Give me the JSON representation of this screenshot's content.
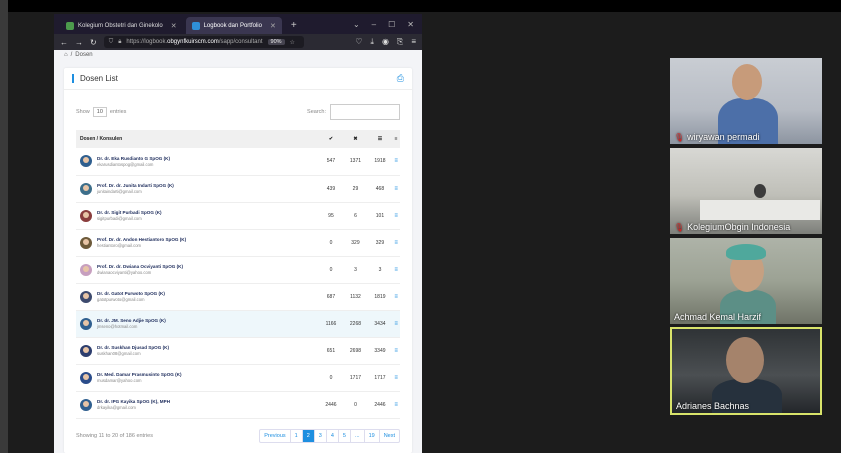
{
  "browser": {
    "tabs": [
      {
        "label": "Kolegium Obstetri dan Ginekolo",
        "active": false
      },
      {
        "label": "Logbook dan Portfolio",
        "active": true
      }
    ],
    "new_tab": "+",
    "url_prefix": "https://logbook.",
    "url_domain": "obgynfkuirscm.com",
    "url_path": "/sapp/consultant",
    "zoom": "90%"
  },
  "breadcrumb": {
    "home": "⌂",
    "sep": "/",
    "current": "Dosen"
  },
  "card": {
    "title": "Dosen List",
    "show_label": "Show",
    "entries_value": "10",
    "entries_label": "entries",
    "search_label": "Search:",
    "search_value": ""
  },
  "table": {
    "headers": [
      "Dosen / Konsulen",
      "✔",
      "✖",
      "☰",
      "≡"
    ],
    "rows": [
      {
        "name": "Dr. dr. Eka Rusdianto G SpOG (K)",
        "email": "ekarusdiantospog@gmail.com",
        "c1": "547",
        "c2": "1371",
        "c3": "1918"
      },
      {
        "name": "Prof. Dr. dr. Junita Indarti SpOG (K)",
        "email": "junitaindarti@gmail.com",
        "c1": "439",
        "c2": "29",
        "c3": "468"
      },
      {
        "name": "Dr. dr. Sigit Purbadi SpOG (K)",
        "email": "sigitpurbadi@gmail.com",
        "c1": "95",
        "c2": "6",
        "c3": "101"
      },
      {
        "name": "Prof. Dr. dr. Andon Hestiantoro SpOG (K)",
        "email": "hestiantoro@gmail.com",
        "c1": "0",
        "c2": "329",
        "c3": "329"
      },
      {
        "name": "Prof. Dr. dr. Dwiana Ocviyanti SpOG (K)",
        "email": "dwianaocviyanti@yahoo.com",
        "c1": "0",
        "c2": "3",
        "c3": "3"
      },
      {
        "name": "Dr. dr. Gatot Purwoto SpOG (K)",
        "email": "gatotpurwoto@gmail.com",
        "c1": "687",
        "c2": "1132",
        "c3": "1819"
      },
      {
        "name": "Dr. dr. JM. Seno Adjie SpOG (K)",
        "email": "jmseno@hotmail.com",
        "c1": "1166",
        "c2": "2268",
        "c3": "3434"
      },
      {
        "name": "Dr. dr. Suskhan Djusad SpOG (K)",
        "email": "suskhan08@gmail.com",
        "c1": "651",
        "c2": "2698",
        "c3": "3349"
      },
      {
        "name": "Dr. Med. Damar Prasmusinto SpOG (K)",
        "email": "musdamar@yahoo.com",
        "c1": "0",
        "c2": "1717",
        "c3": "1717"
      },
      {
        "name": "Dr. dr. IPG Kayika SpOG (K), MPH",
        "email": "drkayika@gmail.com",
        "c1": "2446",
        "c2": "0",
        "c3": "2446"
      }
    ],
    "row_action": "≡"
  },
  "footer": {
    "info": "Showing 11 to 20 of 186 entries",
    "pages": [
      "Previous",
      "1",
      "2",
      "3",
      "4",
      "5",
      "...",
      "19",
      "Next"
    ],
    "active_page": "2"
  },
  "participants": [
    {
      "name": "wiryawan permadi",
      "muted": true
    },
    {
      "name": "KolegiumObgin Indonesia",
      "muted": true
    },
    {
      "name": "Achmad Kemal Harzif",
      "muted": false
    },
    {
      "name": "Adrianes Bachnas",
      "muted": false
    }
  ],
  "icons": {
    "back": "back-arrow-icon",
    "forward": "forward-arrow-icon",
    "reload": "reload-icon",
    "print": "printer-icon",
    "mic_off": "mic-off-icon"
  },
  "colors": {
    "accent": "#1e8fe0",
    "speaker_border": "#d8e36a",
    "mute": "#e02020"
  }
}
